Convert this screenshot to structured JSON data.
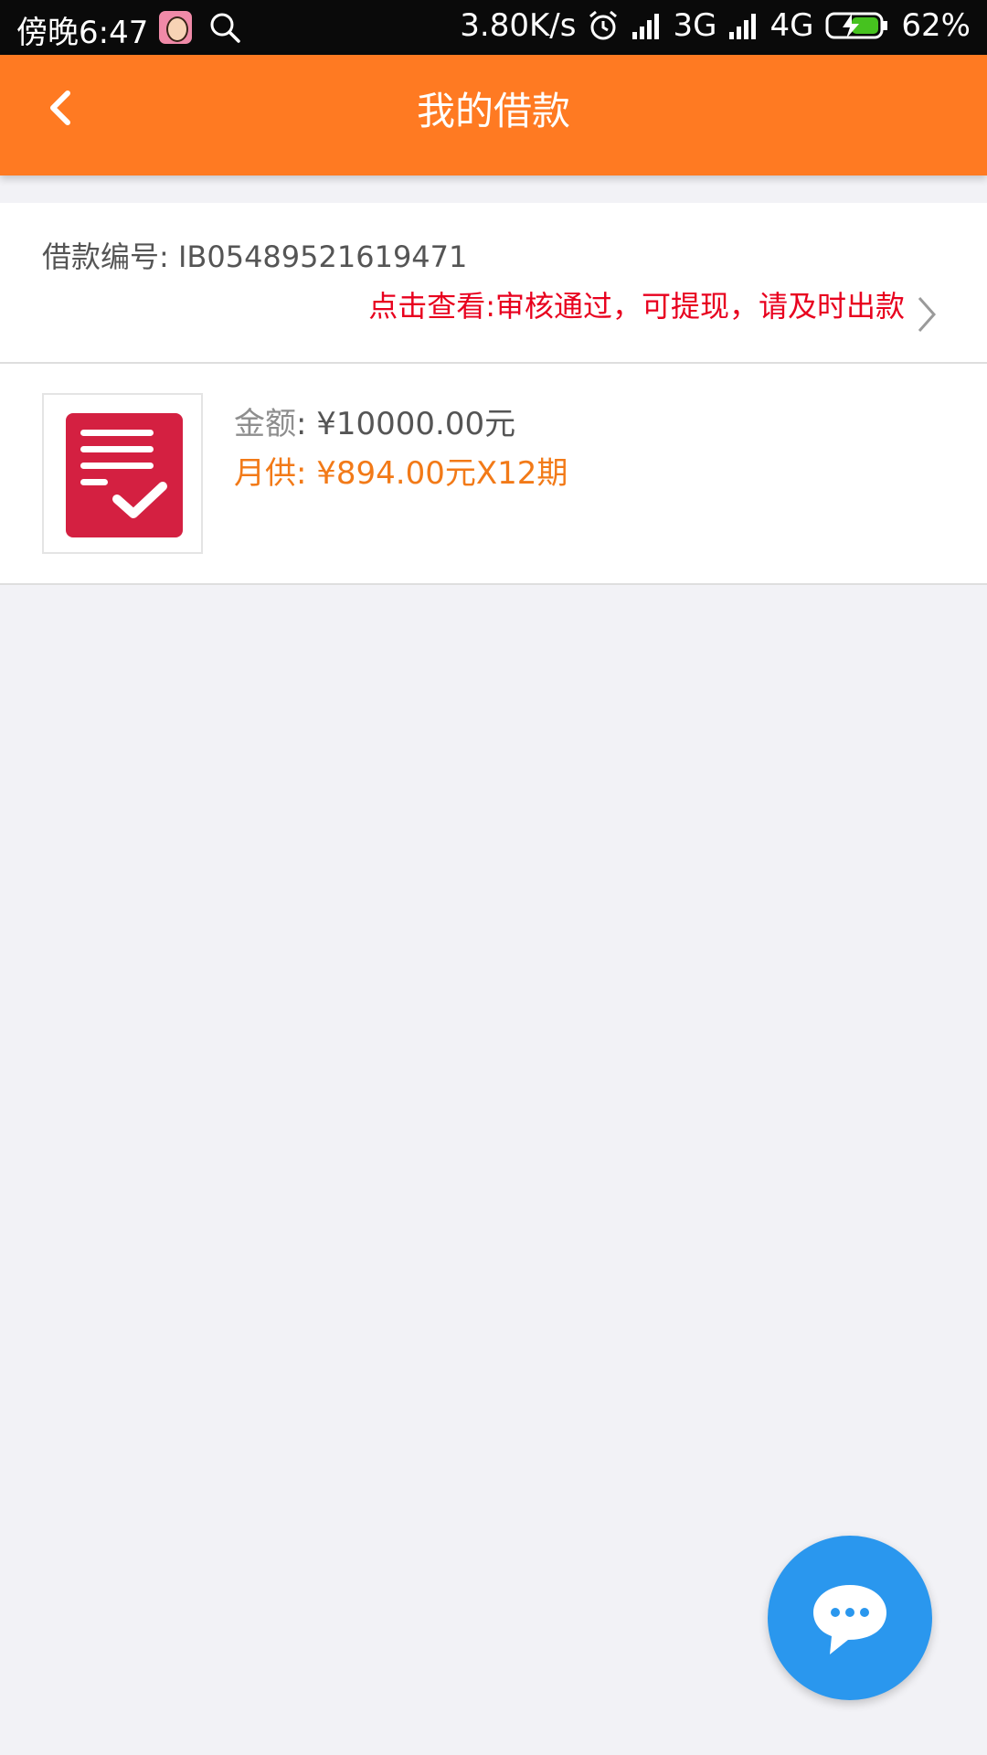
{
  "status_bar": {
    "time": "傍晚6:47",
    "net_speed": "3.80K/s",
    "network_1": "3G",
    "network_2": "4G",
    "battery": "62%",
    "icons": [
      "avatar-icon",
      "search-icon",
      "alarm-icon",
      "signal-icon",
      "signal-icon",
      "battery-charging-icon"
    ]
  },
  "header": {
    "title": "我的借款",
    "back_icon": "chevron-left-icon",
    "background": "#ff7a22"
  },
  "loan": {
    "number_label": "借款编号: IB05489521619471",
    "status_text": "点击查看:审核通过，可提现，请及时出款",
    "amount_label": "金额",
    "amount_value": ": ¥10000.00元",
    "monthly_text": "月供: ¥894.00元X12期",
    "thumb_icon": "document-check-icon",
    "status_color": "#e8001e",
    "monthly_color": "#f27a18"
  },
  "fab": {
    "icon": "chat-bubble-icon",
    "color": "#2a97ee"
  }
}
